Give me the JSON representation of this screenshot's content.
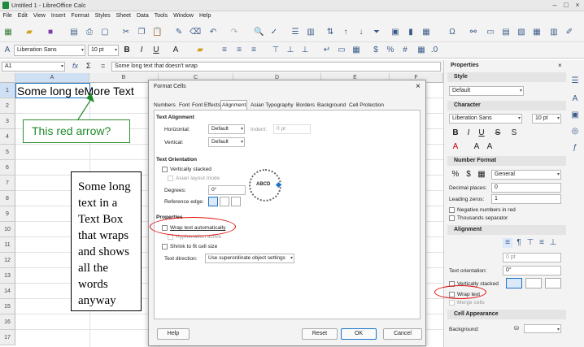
{
  "window": {
    "title": "Untitled 1 - LibreOffice Calc"
  },
  "menu": [
    "File",
    "Edit",
    "View",
    "Insert",
    "Format",
    "Styles",
    "Sheet",
    "Data",
    "Tools",
    "Window",
    "Help"
  ],
  "toolbar2": {
    "font_name": "Liberation Sans",
    "font_size": "10 pt"
  },
  "formula_bar": {
    "cell_ref": "A1",
    "fx": "fx",
    "sigma": "Σ",
    "equals": "=",
    "content": "Some long text that doesn't wrap"
  },
  "sheet": {
    "columns": [
      "A",
      "B",
      "C",
      "D",
      "E",
      "F",
      "G",
      "H",
      "I"
    ],
    "rows": [
      "1",
      "2",
      "3",
      "4",
      "5",
      "6",
      "7",
      "8",
      "9",
      "10",
      "11",
      "12",
      "13",
      "14",
      "15",
      "16",
      "17"
    ],
    "cell_a1_text": "Some long te",
    "cell_b1_text": "More Text"
  },
  "annotations": {
    "callout": "This red arrow?",
    "textbox": "Some long text in a Text Box that wraps and shows all the words anyway"
  },
  "dialog": {
    "title": "Format Cells",
    "close": "×",
    "tabs": [
      "Numbers",
      "Font",
      "Font Effects",
      "Alignment",
      "Asian Typography",
      "Borders",
      "Background",
      "Cell Protection"
    ],
    "text_alignment": {
      "heading": "Text Alignment",
      "horizontal_label": "Horizontal:",
      "horizontal_value": "Default",
      "indent_label": "Indent:",
      "indent_value": "0 pt",
      "vertical_label": "Vertical:",
      "vertical_value": "Default"
    },
    "text_orientation": {
      "heading": "Text Orientation",
      "vertically_stacked": "Vertically stacked",
      "asian_layout": "Asian layout mode",
      "degrees_label": "Degrees:",
      "degrees_value": "0°",
      "reference_edge": "Reference edge:",
      "dial_text": "ABCD"
    },
    "properties": {
      "heading": "Properties",
      "wrap_text": "Wrap text automatically",
      "hyphenation": "Hyphenation active",
      "shrink": "Shrink to fit cell size",
      "text_direction_label": "Text direction:",
      "text_direction_value": "Use superordinate object settings"
    },
    "buttons": {
      "help": "Help",
      "reset": "Reset",
      "ok": "OK",
      "cancel": "Cancel"
    }
  },
  "sidebar": {
    "title": "Properties",
    "style": {
      "heading": "Style",
      "value": "Default"
    },
    "character": {
      "heading": "Character",
      "font": "Liberation Sans",
      "size": "10 pt"
    },
    "number_format": {
      "heading": "Number Format",
      "value": "General",
      "decimal_label": "Decimal places:",
      "decimal_value": "0",
      "leading_label": "Leading zeros:",
      "leading_value": "1",
      "negative_red": "Negative numbers in red",
      "thousands": "Thousands separator"
    },
    "alignment": {
      "heading": "Alignment",
      "indent_value": "0 pt",
      "orientation_label": "Text orientation:",
      "orientation_value": "0°",
      "vertically_stacked": "Vertically stacked",
      "wrap_text": "Wrap text",
      "merge_cells": "Merge cells"
    },
    "cell_appearance": {
      "heading": "Cell Appearance",
      "background_label": "Background:"
    }
  },
  "colors": {
    "callout_green": "#1f8a2a",
    "highlight_red": "#e01010",
    "selection_blue": "#1a73c8"
  }
}
